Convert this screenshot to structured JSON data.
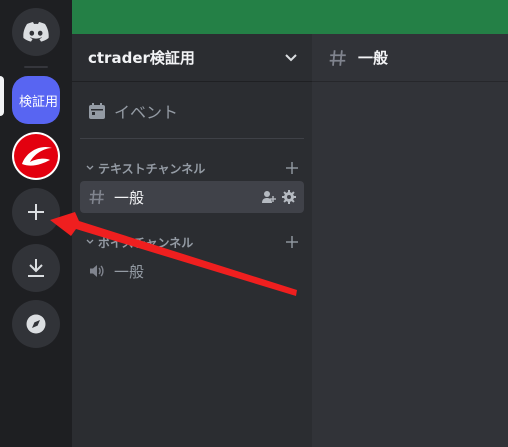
{
  "server_rail": {
    "active_server_label": "検証用",
    "add_label": "+"
  },
  "sidebar": {
    "guild_name": "ctrader検証用",
    "event_label": "イベント",
    "categories": [
      {
        "name": "テキストチャンネル",
        "channels": [
          "一般"
        ]
      },
      {
        "name": "ボイスチャンネル",
        "channels": [
          "一般"
        ]
      }
    ]
  },
  "main": {
    "channel_name": "一般"
  },
  "colors": {
    "rail_bg": "#1e1f22",
    "sidebar_bg": "#2b2d31",
    "main_bg": "#313338",
    "topbar": "#248046",
    "blurple": "#5865f2",
    "annotation_arrow": "#ef1f1f"
  },
  "icons": [
    "discord-logo-icon",
    "chevron-down-icon",
    "calendar-icon",
    "hash-icon",
    "add-member-icon",
    "gear-icon",
    "speaker-icon",
    "plus-icon",
    "download-icon",
    "compass-icon"
  ]
}
